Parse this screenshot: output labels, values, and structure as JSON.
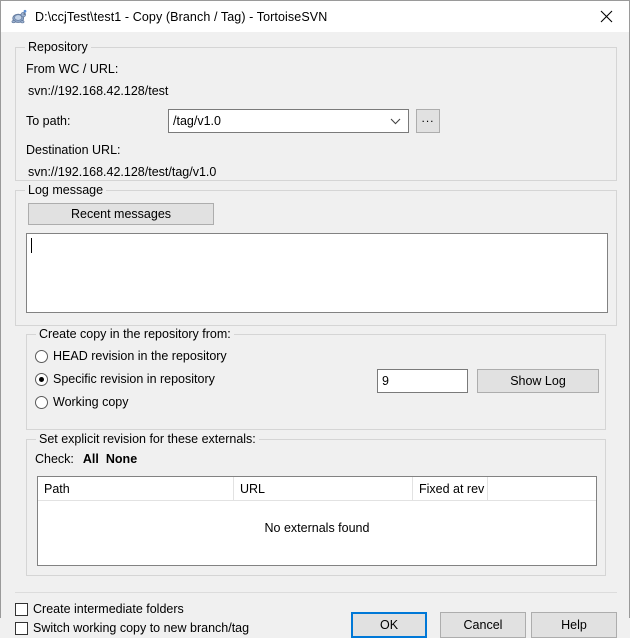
{
  "window": {
    "title": "D:\\ccjTest\\test1 - Copy (Branch / Tag) - TortoiseSVN",
    "icon": "tortoise-svn-icon",
    "close_label": "✕",
    "accent_color": "#0078d7",
    "background_color": "#f0f0f0"
  },
  "repository": {
    "group_title": "Repository",
    "from_label": "From WC / URL:",
    "from_value": "svn://192.168.42.128/test",
    "to_path_label": "To path:",
    "to_path_value": "/tag/v1.0",
    "browse_label": "...",
    "destination_label": "Destination URL:",
    "destination_value": "svn://192.168.42.128/test/tag/v1.0"
  },
  "log_message": {
    "group_title": "Log message",
    "recent_button": "Recent messages",
    "text_value": "",
    "placeholder": ""
  },
  "create_copy": {
    "group_title": "Create copy in the repository from:",
    "options": [
      {
        "label": "HEAD revision in the repository",
        "selected": false
      },
      {
        "label": "Specific revision in repository",
        "selected": true
      },
      {
        "label": "Working copy",
        "selected": false
      }
    ],
    "revision_value": "9",
    "show_log_button": "Show Log"
  },
  "externals": {
    "group_title": "Set explicit revision for these externals:",
    "check_label": "Check:",
    "check_all": "All",
    "check_none": "None",
    "columns": [
      "Path",
      "URL",
      "Fixed at rev",
      ""
    ],
    "rows": [],
    "empty_text": "No externals found"
  },
  "footer": {
    "checkboxes": [
      {
        "label": "Create intermediate folders",
        "checked": false
      },
      {
        "label": "Switch working copy to new branch/tag",
        "checked": false
      }
    ],
    "ok_button": "OK",
    "cancel_button": "Cancel",
    "help_button": "Help"
  }
}
